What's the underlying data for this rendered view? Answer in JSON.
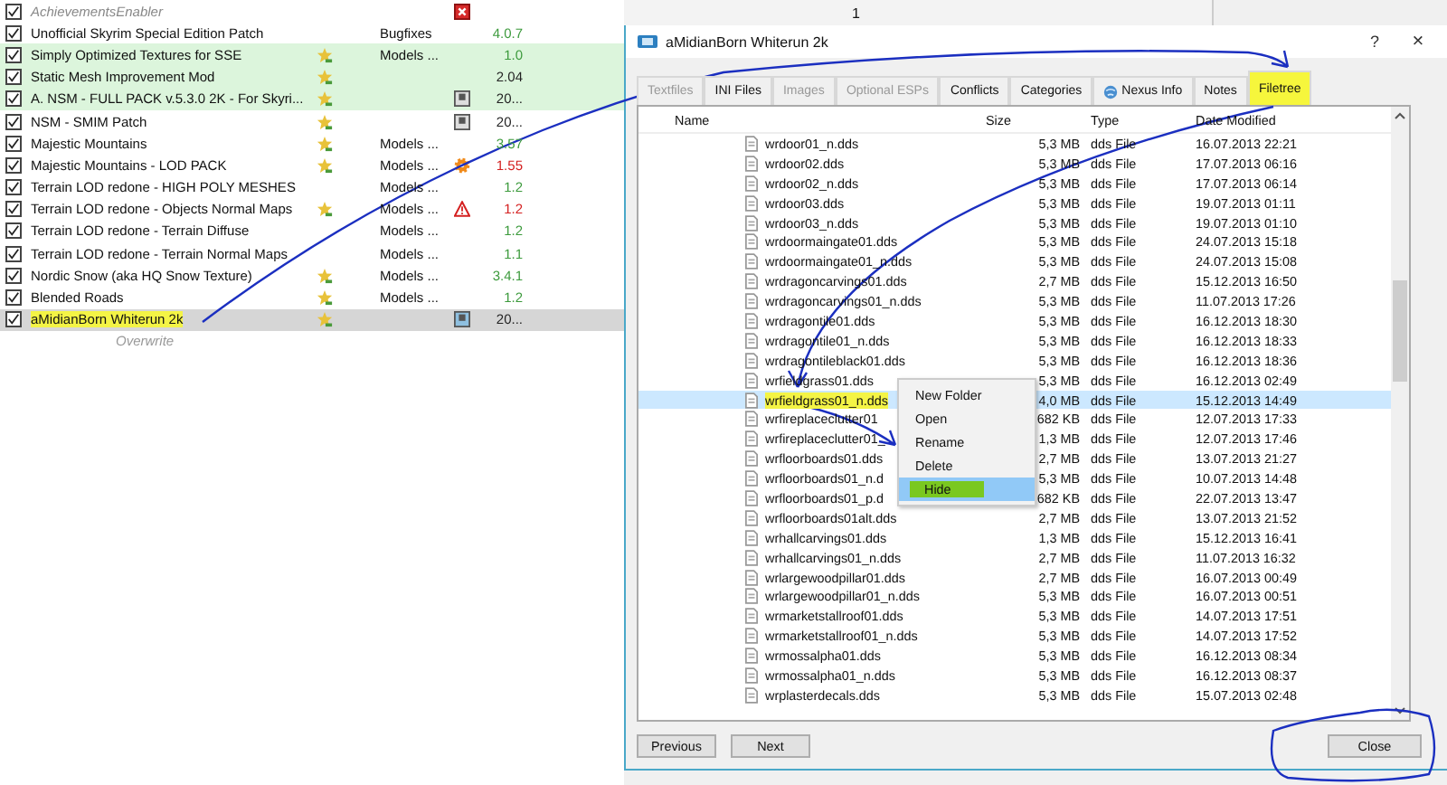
{
  "mod_list": {
    "mods": [
      {
        "name": "AchievementsEnabler",
        "checked": true,
        "inactive": true,
        "endorsed": false,
        "highlighted": false,
        "selected": false,
        "marked": false,
        "flag": {
          "kind": "error"
        }
      },
      {
        "name": "Unofficial Skyrim Special Edition Patch",
        "checked": true,
        "inactive": false,
        "endorsed": false,
        "highlighted": false,
        "selected": false,
        "marked": false,
        "category": "Bugfixes",
        "version": {
          "text": "4.0.7",
          "color": "#3c9a3c"
        }
      },
      {
        "name": "Simply Optimized Textures for SSE",
        "checked": true,
        "inactive": false,
        "endorsed": true,
        "highlighted": true,
        "selected": false,
        "marked": false,
        "category": "Models ...",
        "version": {
          "text": "1.0",
          "color": "#3c9a3c"
        }
      },
      {
        "name": "Static Mesh Improvement Mod",
        "checked": true,
        "inactive": false,
        "endorsed": true,
        "highlighted": true,
        "selected": false,
        "marked": false,
        "version": {
          "text": "2.04",
          "color": "#222222"
        }
      },
      {
        "name": "A. NSM - FULL PACK v.5.3.0 2K - For Skyri...",
        "checked": true,
        "inactive": false,
        "endorsed": true,
        "highlighted": true,
        "selected": false,
        "marked": false,
        "flag": {
          "kind": "archive"
        },
        "version": {
          "text": "20...",
          "color": "#222222"
        }
      },
      {
        "name": "NSM - SMIM Patch",
        "checked": true,
        "inactive": false,
        "endorsed": true,
        "highlighted": false,
        "selected": false,
        "marked": false,
        "flag": {
          "kind": "archive"
        },
        "version": {
          "text": "20...",
          "color": "#222222"
        }
      },
      {
        "name": "Majestic Mountains",
        "checked": true,
        "inactive": false,
        "endorsed": true,
        "highlighted": false,
        "selected": false,
        "marked": false,
        "category": "Models ...",
        "version": {
          "text": "3.57",
          "color": "#3c9a3c"
        }
      },
      {
        "name": "Majestic Mountains - LOD PACK",
        "checked": true,
        "inactive": false,
        "endorsed": true,
        "highlighted": false,
        "selected": false,
        "marked": false,
        "category": "Models ...",
        "flag": {
          "kind": "gear"
        },
        "version": {
          "text": "1.55",
          "color": "#d42020"
        }
      },
      {
        "name": "Terrain LOD redone - HIGH POLY MESHES",
        "checked": true,
        "inactive": false,
        "endorsed": false,
        "highlighted": false,
        "selected": false,
        "marked": false,
        "category": "Models ...",
        "version": {
          "text": "1.2",
          "color": "#3c9a3c"
        }
      },
      {
        "name": "Terrain LOD redone - Objects Normal Maps",
        "checked": true,
        "inactive": false,
        "endorsed": true,
        "highlighted": false,
        "selected": false,
        "marked": false,
        "category": "Models ...",
        "flag": {
          "kind": "warning"
        },
        "version": {
          "text": "1.2",
          "color": "#d42020"
        }
      },
      {
        "name": "Terrain LOD redone - Terrain Diffuse",
        "checked": true,
        "inactive": false,
        "endorsed": false,
        "highlighted": false,
        "selected": false,
        "marked": false,
        "category": "Models ...",
        "version": {
          "text": "1.2",
          "color": "#3c9a3c"
        }
      },
      {
        "name": "Terrain LOD redone - Terrain Normal Maps",
        "checked": true,
        "inactive": false,
        "endorsed": false,
        "highlighted": false,
        "selected": false,
        "marked": false,
        "category": "Models ...",
        "version": {
          "text": "1.1",
          "color": "#3c9a3c"
        }
      },
      {
        "name": "Nordic Snow (aka HQ Snow Texture)",
        "checked": true,
        "inactive": false,
        "endorsed": true,
        "highlighted": false,
        "selected": false,
        "marked": false,
        "category": "Models ...",
        "version": {
          "text": "3.4.1",
          "color": "#3c9a3c"
        }
      },
      {
        "name": "Blended Roads",
        "checked": true,
        "inactive": false,
        "endorsed": true,
        "highlighted": false,
        "selected": false,
        "marked": false,
        "category": "Models ...",
        "version": {
          "text": "1.2",
          "color": "#3c9a3c"
        }
      },
      {
        "name": "aMidianBorn Whiterun 2k",
        "checked": true,
        "inactive": false,
        "endorsed": true,
        "highlighted": false,
        "selected": true,
        "marked": true,
        "flag": {
          "kind": "archive"
        },
        "version": {
          "text": "20...",
          "color": "#222222"
        }
      }
    ],
    "overwrite": "Overwrite"
  },
  "background_table": {
    "cell": "1"
  },
  "dialog": {
    "title": "aMidianBorn Whiterun 2k",
    "help": "?",
    "close": "×",
    "tabs": [
      {
        "label": "Textfiles",
        "disabled": true,
        "selected": false,
        "marked": false
      },
      {
        "label": "INI Files",
        "disabled": false,
        "selected": false,
        "marked": false
      },
      {
        "label": "Images",
        "disabled": true,
        "selected": false,
        "marked": false
      },
      {
        "label": "Optional ESPs",
        "disabled": true,
        "selected": false,
        "marked": false
      },
      {
        "label": "Conflicts",
        "disabled": false,
        "selected": false,
        "marked": false
      },
      {
        "label": "Categories",
        "disabled": false,
        "selected": false,
        "marked": false
      },
      {
        "label": "Nexus Info",
        "disabled": false,
        "selected": false,
        "marked": false,
        "kind": "web"
      },
      {
        "label": "Notes",
        "disabled": false,
        "selected": false,
        "marked": false
      },
      {
        "label": "Filetree",
        "disabled": false,
        "selected": true,
        "marked": true
      }
    ],
    "columns": [
      "Name",
      "Size",
      "Type",
      "Date Modified"
    ],
    "files": [
      {
        "name": "wrdoor01_n.dds",
        "size": "5,3 MB",
        "type": "dds File",
        "date": "16.07.2013 22:21",
        "selected": false,
        "marked": false
      },
      {
        "name": "wrdoor02.dds",
        "size": "5,3 MB",
        "type": "dds File",
        "date": "17.07.2013 06:16",
        "selected": false,
        "marked": false
      },
      {
        "name": "wrdoor02_n.dds",
        "size": "5,3 MB",
        "type": "dds File",
        "date": "17.07.2013 06:14",
        "selected": false,
        "marked": false
      },
      {
        "name": "wrdoor03.dds",
        "size": "5,3 MB",
        "type": "dds File",
        "date": "19.07.2013 01:11",
        "selected": false,
        "marked": false
      },
      {
        "name": "wrdoor03_n.dds",
        "size": "5,3 MB",
        "type": "dds File",
        "date": "19.07.2013 01:10",
        "selected": false,
        "marked": false
      },
      {
        "name": "wrdoormaingate01.dds",
        "size": "5,3 MB",
        "type": "dds File",
        "date": "24.07.2013 15:18",
        "selected": false,
        "marked": false
      },
      {
        "name": "wrdoormaingate01_n.dds",
        "size": "5,3 MB",
        "type": "dds File",
        "date": "24.07.2013 15:08",
        "selected": false,
        "marked": false
      },
      {
        "name": "wrdragoncarvings01.dds",
        "size": "2,7 MB",
        "type": "dds File",
        "date": "15.12.2013 16:50",
        "selected": false,
        "marked": false
      },
      {
        "name": "wrdragoncarvings01_n.dds",
        "size": "5,3 MB",
        "type": "dds File",
        "date": "11.07.2013 17:26",
        "selected": false,
        "marked": false
      },
      {
        "name": "wrdragontile01.dds",
        "size": "5,3 MB",
        "type": "dds File",
        "date": "16.12.2013 18:30",
        "selected": false,
        "marked": false
      },
      {
        "name": "wrdragontile01_n.dds",
        "size": "5,3 MB",
        "type": "dds File",
        "date": "16.12.2013 18:33",
        "selected": false,
        "marked": false
      },
      {
        "name": "wrdragontileblack01.dds",
        "size": "5,3 MB",
        "type": "dds File",
        "date": "16.12.2013 18:36",
        "selected": false,
        "marked": false
      },
      {
        "name": "wrfieldgrass01.dds",
        "size": "5,3 MB",
        "type": "dds File",
        "date": "16.12.2013 02:49",
        "selected": false,
        "marked": false
      },
      {
        "name": "wrfieldgrass01_n.dds",
        "size": "4,0 MB",
        "type": "dds File",
        "date": "15.12.2013 14:49",
        "selected": true,
        "marked": true
      },
      {
        "name": "wrfireplaceclutter01",
        "size": "682 KB",
        "type": "dds File",
        "date": "12.07.2013 17:33",
        "selected": false,
        "marked": false
      },
      {
        "name": "wrfireplaceclutter01_",
        "size": "1,3 MB",
        "type": "dds File",
        "date": "12.07.2013 17:46",
        "selected": false,
        "marked": false
      },
      {
        "name": "wrfloorboards01.dds",
        "size": "2,7 MB",
        "type": "dds File",
        "date": "13.07.2013 21:27",
        "selected": false,
        "marked": false
      },
      {
        "name": "wrfloorboards01_n.d",
        "size": "5,3 MB",
        "type": "dds File",
        "date": "10.07.2013 14:48",
        "selected": false,
        "marked": false
      },
      {
        "name": "wrfloorboards01_p.d",
        "size": "682 KB",
        "type": "dds File",
        "date": "22.07.2013 13:47",
        "selected": false,
        "marked": false
      },
      {
        "name": "wrfloorboards01alt.dds",
        "size": "2,7 MB",
        "type": "dds File",
        "date": "13.07.2013 21:52",
        "selected": false,
        "marked": false
      },
      {
        "name": "wrhallcarvings01.dds",
        "size": "1,3 MB",
        "type": "dds File",
        "date": "15.12.2013 16:41",
        "selected": false,
        "marked": false
      },
      {
        "name": "wrhallcarvings01_n.dds",
        "size": "2,7 MB",
        "type": "dds File",
        "date": "11.07.2013 16:32",
        "selected": false,
        "marked": false
      },
      {
        "name": "wrlargewoodpillar01.dds",
        "size": "2,7 MB",
        "type": "dds File",
        "date": "16.07.2013 00:49",
        "selected": false,
        "marked": false
      },
      {
        "name": "wrlargewoodpillar01_n.dds",
        "size": "5,3 MB",
        "type": "dds File",
        "date": "16.07.2013 00:51",
        "selected": false,
        "marked": false
      },
      {
        "name": "wrmarketstallroof01.dds",
        "size": "5,3 MB",
        "type": "dds File",
        "date": "14.07.2013 17:51",
        "selected": false,
        "marked": false
      },
      {
        "name": "wrmarketstallroof01_n.dds",
        "size": "5,3 MB",
        "type": "dds File",
        "date": "14.07.2013 17:52",
        "selected": false,
        "marked": false
      },
      {
        "name": "wrmossalpha01.dds",
        "size": "5,3 MB",
        "type": "dds File",
        "date": "16.12.2013 08:34",
        "selected": false,
        "marked": false
      },
      {
        "name": "wrmossalpha01_n.dds",
        "size": "5,3 MB",
        "type": "dds File",
        "date": "16.12.2013 08:37",
        "selected": false,
        "marked": false
      },
      {
        "name": "wrplasterdecals.dds",
        "size": "5,3 MB",
        "type": "dds File",
        "date": "15.07.2013 02:48",
        "selected": false,
        "marked": false
      }
    ],
    "context_menu": [
      {
        "label": "New Folder",
        "selected": false,
        "marked": false
      },
      {
        "label": "Open",
        "selected": false,
        "marked": false
      },
      {
        "label": "Rename",
        "selected": false,
        "marked": false
      },
      {
        "label": "Delete",
        "selected": false,
        "marked": false
      },
      {
        "label": "Hide",
        "selected": true,
        "marked": true
      }
    ],
    "buttons": [
      "Previous",
      "Next"
    ],
    "close_button": "Close"
  }
}
